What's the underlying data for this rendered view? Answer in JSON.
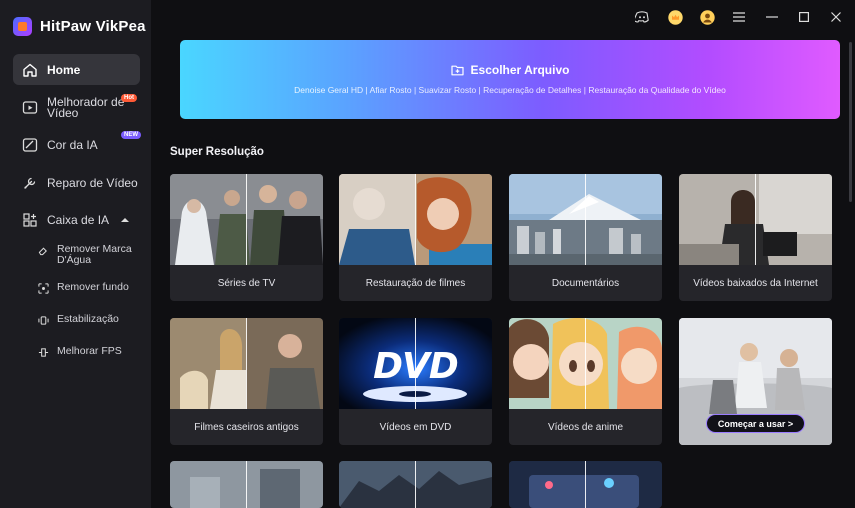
{
  "app": {
    "name": "HitPaw VikPea"
  },
  "sidebar": {
    "items": [
      {
        "label": "Home",
        "icon": "home-icon",
        "active": true
      },
      {
        "label": "Melhorador de Vídeo",
        "icon": "video-enhancer-icon",
        "badge": "Hot"
      },
      {
        "label": "Cor da IA",
        "icon": "ai-color-icon",
        "badge": "NEW"
      },
      {
        "label": "Reparo de Vídeo",
        "icon": "video-repair-icon"
      },
      {
        "label": "Caixa de IA",
        "icon": "ai-toolbox-icon",
        "expanded": true
      }
    ],
    "subitems": [
      {
        "label": "Remover Marca D'Água",
        "icon": "eraser-icon"
      },
      {
        "label": "Remover fundo",
        "icon": "background-remove-icon"
      },
      {
        "label": "Estabilização",
        "icon": "stabilization-icon"
      },
      {
        "label": "Melhorar FPS",
        "icon": "fps-icon"
      }
    ]
  },
  "topbar": {
    "icons": [
      "discord-icon",
      "premium-crown-icon",
      "user-avatar-icon",
      "menu-icon",
      "minimize-icon",
      "maximize-icon",
      "close-icon"
    ]
  },
  "banner": {
    "title": "Escolher Arquivo",
    "subtitle": "Denoise Geral HD | Afiar Rosto | Suavizar Rosto | Recuperação de Detalhes | Restauração da Qualidade do Vídeo"
  },
  "section": {
    "title": "Super Resolução"
  },
  "cards": [
    {
      "label": "Séries de TV"
    },
    {
      "label": "Restauração de filmes"
    },
    {
      "label": "Documentários"
    },
    {
      "label": "Vídeos baixados da Internet"
    },
    {
      "label": "Filmes caseiros antigos"
    },
    {
      "label": "Vídeos em DVD"
    },
    {
      "label": "Vídeos de anime"
    },
    {
      "label": "",
      "button": "Começar a usar >"
    }
  ],
  "dvd_logo": "DVD",
  "colors": {
    "sidebar_bg": "#1c1c21",
    "active_item": "#35353b",
    "accent": "#7d5cff",
    "hot_badge": "#ff5a36"
  }
}
